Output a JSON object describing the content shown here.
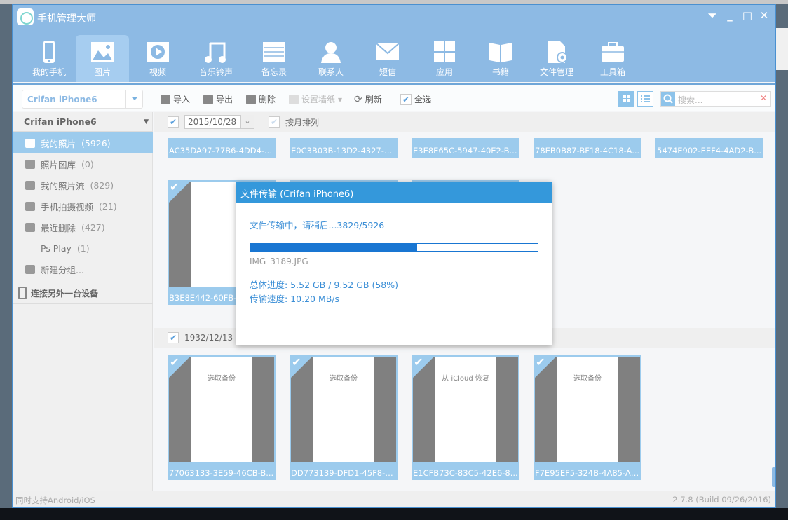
{
  "app": {
    "title": "手机管理大师",
    "accent": "#8dbae4",
    "dialog_accent": "#3498db"
  },
  "window_controls": [
    "menu",
    "minimize",
    "maximize",
    "close"
  ],
  "nav": [
    {
      "label": "我的手机",
      "icon": "phone-icon"
    },
    {
      "label": "图片",
      "icon": "picture-icon",
      "active": true
    },
    {
      "label": "视频",
      "icon": "video-icon"
    },
    {
      "label": "音乐铃声",
      "icon": "music-icon"
    },
    {
      "label": "备忘录",
      "icon": "memo-icon"
    },
    {
      "label": "联系人",
      "icon": "contact-icon"
    },
    {
      "label": "短信",
      "icon": "message-icon"
    },
    {
      "label": "应用",
      "icon": "apps-icon"
    },
    {
      "label": "书籍",
      "icon": "book-icon"
    },
    {
      "label": "文件管理",
      "icon": "file-manager-icon"
    },
    {
      "label": "工具箱",
      "icon": "toolbox-icon"
    }
  ],
  "device_select": {
    "value": "Crifan iPhone6"
  },
  "toolbar": {
    "import": "导入",
    "export": "导出",
    "delete": "删除",
    "wallpaper": "设置墙纸",
    "refresh": "刷新",
    "select_all": "全选",
    "search_placeholder": "搜索..."
  },
  "sidebar": {
    "device": "Crifan iPhone6",
    "items": [
      {
        "label": "我的照片",
        "count": "(5926)",
        "active": true
      },
      {
        "label": "照片图库",
        "count": "(0)"
      },
      {
        "label": "我的照片流",
        "count": "(829)"
      },
      {
        "label": "手机拍摄视频",
        "count": "(21)"
      },
      {
        "label": "最近删除",
        "count": "(427)"
      },
      {
        "label": "Ps Play",
        "count": "(1)"
      },
      {
        "label": "新建分组...",
        "count": ""
      }
    ],
    "connect": "连接另外一台设备"
  },
  "groups": [
    {
      "date": "2015/10/28",
      "sort_by_month": "按月排列"
    },
    {
      "date": "1932/12/13"
    }
  ],
  "top_row_captions": [
    "AC35DA97-77B6-4DD4-B...",
    "E0C3B03B-13D2-4327-8...",
    "E3E8E65C-5947-40E2-B...",
    "78EB0B87-BF18-4C18-A...",
    "5474E902-EEF4-4AD2-B..."
  ],
  "row2": [
    {
      "caption": "B3E8E442-60FB-..."
    },
    {
      "caption": ""
    },
    {
      "caption": ""
    }
  ],
  "row3": [
    {
      "caption": "77063133-3E59-46CB-B...",
      "screen": "选取备份"
    },
    {
      "caption": "DD773139-DFD1-45F8-9...",
      "screen": "选取备份"
    },
    {
      "caption": "E1CFB73C-83C5-42E6-8...",
      "screen": "从 iCloud 恢复"
    },
    {
      "caption": "F7E95EF5-324B-4A85-A2...",
      "screen": "选取备份"
    }
  ],
  "statusbar": {
    "left": "同时支持Android/iOS",
    "version": "2.7.8 (Build 09/26/2016)"
  },
  "dialog": {
    "title": "文件传输 (Crifan iPhone6)",
    "message": "文件传输中，请稍后...3829/5926",
    "progress_percent": 58,
    "file": "IMG_3189.JPG",
    "total": "总体进度: 5.52 GB / 9.52 GB (58%)",
    "speed": "传输速度: 10.20 MB/s"
  }
}
